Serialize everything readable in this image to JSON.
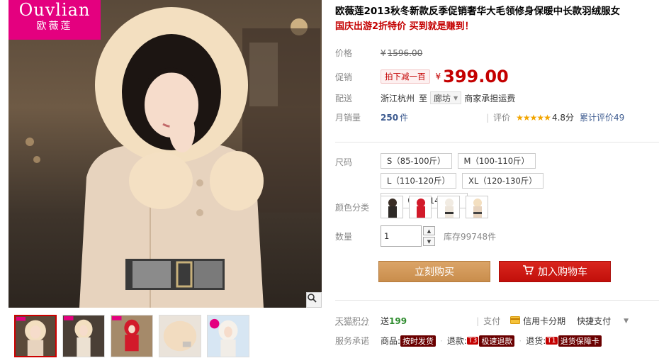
{
  "brand": {
    "latin": "Ouvlian",
    "cjk": "欧薇莲"
  },
  "product": {
    "title": "欧薇莲2013秋冬新款反季促销奢华大毛领修身保暖中长款羽绒服女",
    "slogan": "国庆出游2折特价 买到就是赚到！"
  },
  "price": {
    "label": "价格",
    "currency": "¥",
    "original": "1596.00"
  },
  "promo": {
    "label": "促销",
    "tag": "拍下减一百",
    "currency": "¥",
    "price": "399.00"
  },
  "shipping": {
    "label": "配送",
    "from": "浙江杭州",
    "to_word": "至",
    "dest": "廊坊",
    "note": "商家承担运费"
  },
  "sales": {
    "label": "月销量",
    "count": "250",
    "unit": "件",
    "rating_label": "评价",
    "stars": "★★★★★",
    "score": "4.8分",
    "total_reviews": "累计评价49"
  },
  "size": {
    "label": "尺码",
    "options": [
      "S（85-100斤）",
      "M（100-110斤）",
      "L（110-120斤）",
      "XL（120-130斤）",
      "XXL（130-140斤）"
    ]
  },
  "color": {
    "label": "颜色分类"
  },
  "quantity": {
    "label": "数量",
    "value": "1",
    "stock": "库存99748件"
  },
  "actions": {
    "buy_now": "立刻购买",
    "add_to_cart": "加入购物车"
  },
  "points": {
    "label": "天猫积分",
    "text": "送",
    "value": "199"
  },
  "payment": {
    "label": "支付",
    "credit": "信用卡分期",
    "quick": "快捷支付"
  },
  "service": {
    "label": "服务承诺",
    "goods_label": "商品:",
    "goods_badge": "按时发货",
    "refund_label": "退款:",
    "refund_code": "T3",
    "refund_badge": "极速退款",
    "return_label": "退货:",
    "return_code": "T1",
    "return_badge": "退货保障卡"
  },
  "colors": {
    "accent_red": "#c40000",
    "brand_pink": "#e4007f",
    "buy_button": "#d39a5b",
    "cart_button": "#c10f0a"
  }
}
